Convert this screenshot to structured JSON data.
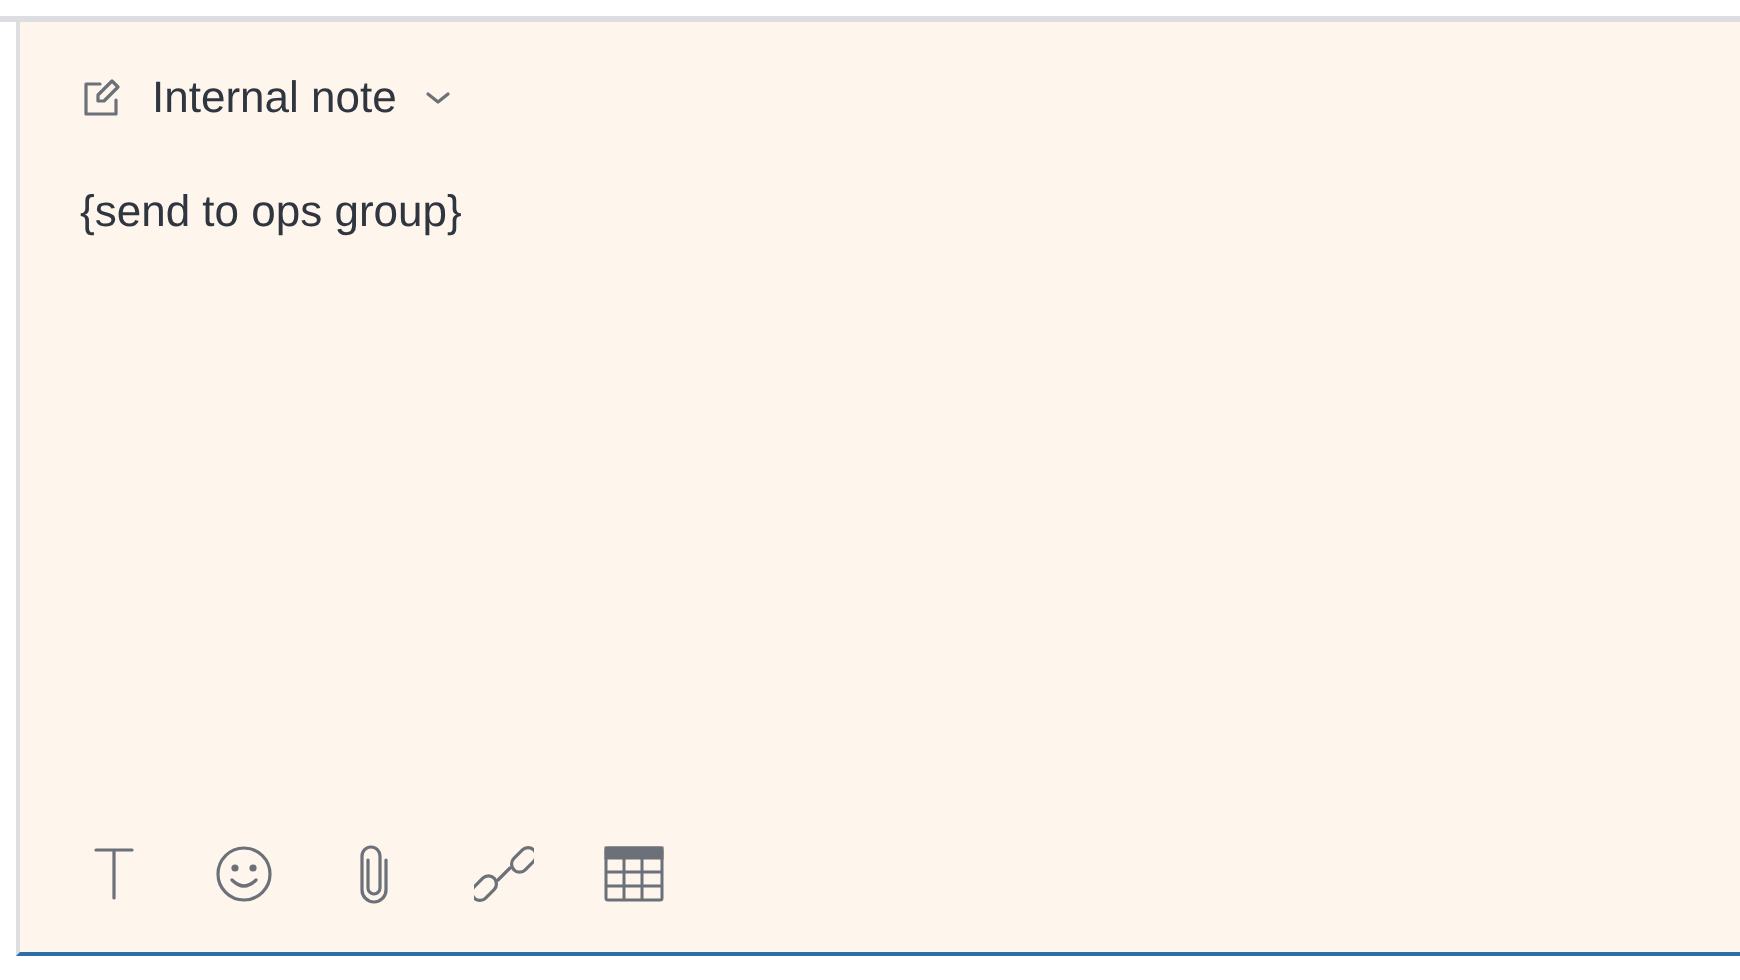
{
  "note_type": {
    "label": "Internal note"
  },
  "editor": {
    "value": "{send to ops group}"
  }
}
